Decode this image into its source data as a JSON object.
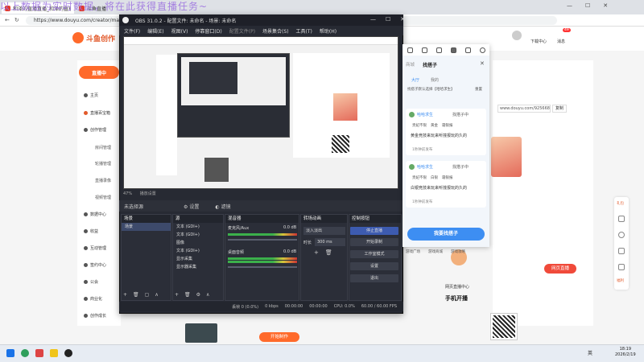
{
  "browser": {
    "tabs": [
      {
        "label": "和泽的直播直播_和泽的直播视频"
      },
      {
        "label": "斗鱼直播"
      },
      {
        "label": ""
      }
    ],
    "url": "https://www.douyu.com/creator/main/live",
    "overlay": "以上数据为实时数据，将在此获得直播任务~"
  },
  "page": {
    "logo": "斗鱼创作",
    "live_button": "直播中",
    "sidebar": [
      {
        "label": "主页",
        "icon": "home-icon"
      },
      {
        "label": "直播百宝箱",
        "icon": "box-icon"
      },
      {
        "label": "创作管理",
        "icon": "manage-icon"
      },
      {
        "label": "房间管理",
        "sub": true
      },
      {
        "label": "轮播管理",
        "sub": true
      },
      {
        "label": "直播录像",
        "sub": true
      },
      {
        "label": "视频管理",
        "sub": true
      },
      {
        "label": "数据中心",
        "icon": "data-icon"
      },
      {
        "label": "收益",
        "icon": "income-icon"
      },
      {
        "label": "互动管理",
        "icon": "interact-icon"
      },
      {
        "label": "签约中心",
        "icon": "sign-icon"
      },
      {
        "label": "公会",
        "icon": "guild-icon"
      },
      {
        "label": "商业化",
        "icon": "biz-icon"
      },
      {
        "label": "创作成长",
        "icon": "grow-icon"
      }
    ],
    "header_right": {
      "download": "下载中心",
      "messages": "消息",
      "badge": "49"
    },
    "right": {
      "link": "www.douyu.com/925668",
      "copy": "复制",
      "open_btn": "网页直播",
      "mobile": "手机开播",
      "web_live": "网页直播中心"
    },
    "bottom_btn": "开始制作",
    "floatbar": [
      "礼包",
      "",
      "",
      "",
      "",
      "",
      "福利"
    ]
  },
  "obs": {
    "title": "OBS 31.0.2 - 配置文件: 未命名 - 场景: 未命名",
    "menu": [
      "文件(F)",
      "编辑(E)",
      "视图(V)",
      "停靠窗口(D)",
      "配置文件(P)",
      "场景集合(S)",
      "工具(T)",
      "帮助(H)"
    ],
    "zoom": "47%",
    "status_left": "播放设置",
    "no_source": "未选择源",
    "props": "设置",
    "filters": "滤镜",
    "docks": {
      "scenes": {
        "title": "场景",
        "items": [
          "场景"
        ]
      },
      "sources": {
        "title": "源",
        "items": [
          "文本 (GDI+)",
          "文本 (GDI+)",
          "图像",
          "文本 (GDI+)",
          "显示采集",
          "显示器采集"
        ]
      },
      "mixer": {
        "title": "混音器",
        "ch1": "麦克风/Aux",
        "db1": "0.0 dB",
        "ch2": "桌面音频",
        "db2": "0.0 dB"
      },
      "transitions": {
        "title": "转场动画",
        "type": "淡入淡出",
        "duration_label": "时长",
        "duration": "300 ms"
      },
      "controls": {
        "title": "控制按钮",
        "buttons": [
          "停止直播",
          "开始录制",
          "工作室模式",
          "设置",
          "退出"
        ]
      }
    },
    "status": {
      "frames": "丢帧 0 (0.0%)",
      "kbps": "0 kbps",
      "time1": "00:00:00",
      "time2": "00:00:00",
      "cpu": "CPU: 0.0%",
      "fps": "60.00 / 60.00 FPS"
    }
  },
  "popup": {
    "tabs": [
      "商城",
      "找搭子"
    ],
    "title": "找搭子",
    "subtabs": [
      "大厅",
      "我的"
    ],
    "filter": "找搭子默认选择【哈哈求生】",
    "reset": "重置",
    "cards": [
      {
        "user": "哈哈求生",
        "tag": "找搭子中",
        "chips": [
          "贵妃不限",
          "黄金",
          "霜银报"
        ],
        "text": "黄金竞技来玩来听撞报玩的久的",
        "time": "1秒钟前发布"
      },
      {
        "user": "哈哈求生",
        "tag": "找搭子中",
        "chips": [
          "贵妃不限",
          "白银",
          "霜银报"
        ],
        "text": "白银竞技来玩来听撞报玩的久的",
        "time": "1秒钟前发布"
      }
    ],
    "find_btn": "我要找搭子",
    "footer": [
      "游戏广场",
      "游戏商城",
      "游戏攻略"
    ]
  },
  "taskbar": {
    "time": "18:19",
    "date": "2026/2/19",
    "lang": "英"
  }
}
